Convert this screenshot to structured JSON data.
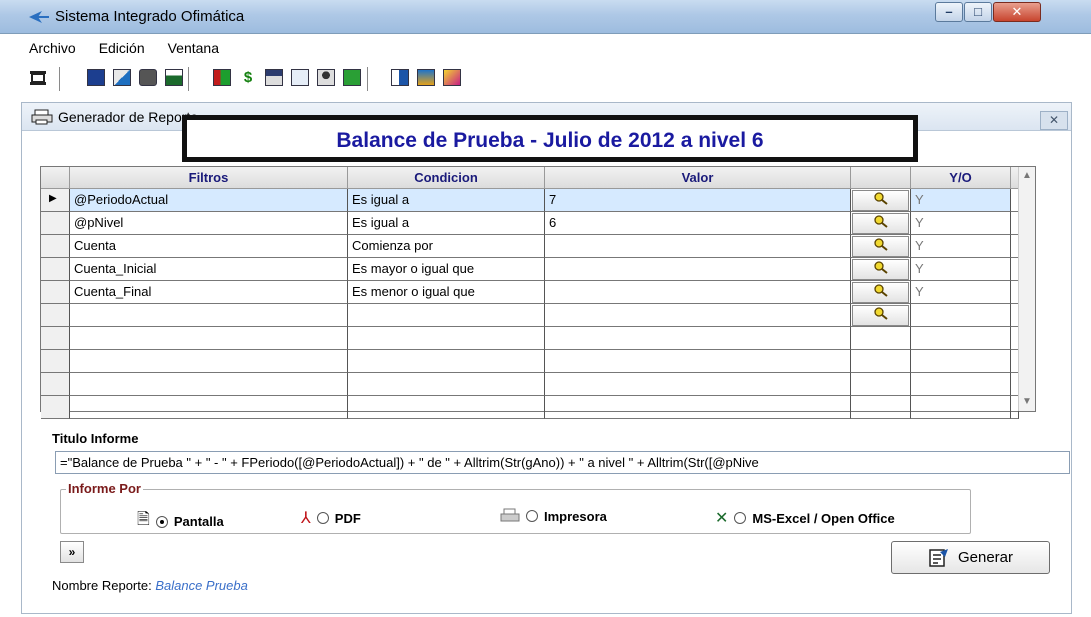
{
  "window": {
    "title": "Sistema Integrado Ofimática",
    "minimize_glyph": "–",
    "maximize_glyph": "□",
    "close_glyph": "✕"
  },
  "menu": {
    "items": [
      "Archivo",
      "Edición",
      "Ventana"
    ]
  },
  "toolbar": {
    "icons": [
      "printer-setup-icon",
      "calculator-icon",
      "report-icon",
      "print-icon",
      "excel-icon",
      "chart-icon",
      "dollar-icon",
      "window-icon",
      "network-icon",
      "user-icon",
      "grid-icon",
      "form-icon",
      "people-icon",
      "graph-icon"
    ]
  },
  "panel": {
    "title": "Generador de Reporte",
    "close_glyph": "✕"
  },
  "banner": {
    "text": "Balance de Prueba  - Julio de 2012 a nivel 6"
  },
  "grid": {
    "columns": [
      "Filtros",
      "Condicion",
      "Valor",
      "",
      "Y/O",
      ""
    ],
    "rows": [
      {
        "filtro": "@PeriodoActual",
        "condicion": "Es igual a",
        "valor": "7",
        "yo": "Y",
        "current": true
      },
      {
        "filtro": "@pNivel",
        "condicion": "Es igual a",
        "valor": "6",
        "yo": "Y"
      },
      {
        "filtro": "Cuenta",
        "condicion": "Comienza por",
        "valor": "",
        "yo": "Y"
      },
      {
        "filtro": "Cuenta_Inicial",
        "condicion": "Es mayor o igual que",
        "valor": "",
        "yo": "Y"
      },
      {
        "filtro": "Cuenta_Final",
        "condicion": "Es menor o igual que",
        "valor": "",
        "yo": "Y"
      },
      {
        "filtro": "",
        "condicion": "",
        "valor": "",
        "yo": ""
      }
    ],
    "empty_rows": 4,
    "current_row_marker": "▶",
    "lookup_icon": "search-key-icon"
  },
  "titulo": {
    "label": "Titulo Informe",
    "value": "=\"Balance de Prueba \"  +  \" - \" + FPeriodo([@PeriodoActual]) + \" de \" + Alltrim(Str(gAno)) + \" a nivel \" + Alltrim(Str([@pNive"
  },
  "informe_por": {
    "legend": "Informe Por",
    "options": [
      {
        "label": "Pantalla",
        "icon": "document-icon",
        "selected": true
      },
      {
        "label": "PDF",
        "icon": "pdf-icon",
        "selected": false
      },
      {
        "label": "Impresora",
        "icon": "printer-icon",
        "selected": false
      },
      {
        "label": "MS-Excel / Open Office",
        "icon": "excel-icon",
        "selected": false
      }
    ]
  },
  "buttons": {
    "expand": "»",
    "generar": "Generar"
  },
  "nombre_reporte": {
    "label": "Nombre Reporte:",
    "value": "Balance Prueba"
  },
  "colors": {
    "banner_text": "#1a1aa0",
    "selected_row": "#d6eaff",
    "legend": "#7a1a1a",
    "link": "#3a6fc9"
  }
}
